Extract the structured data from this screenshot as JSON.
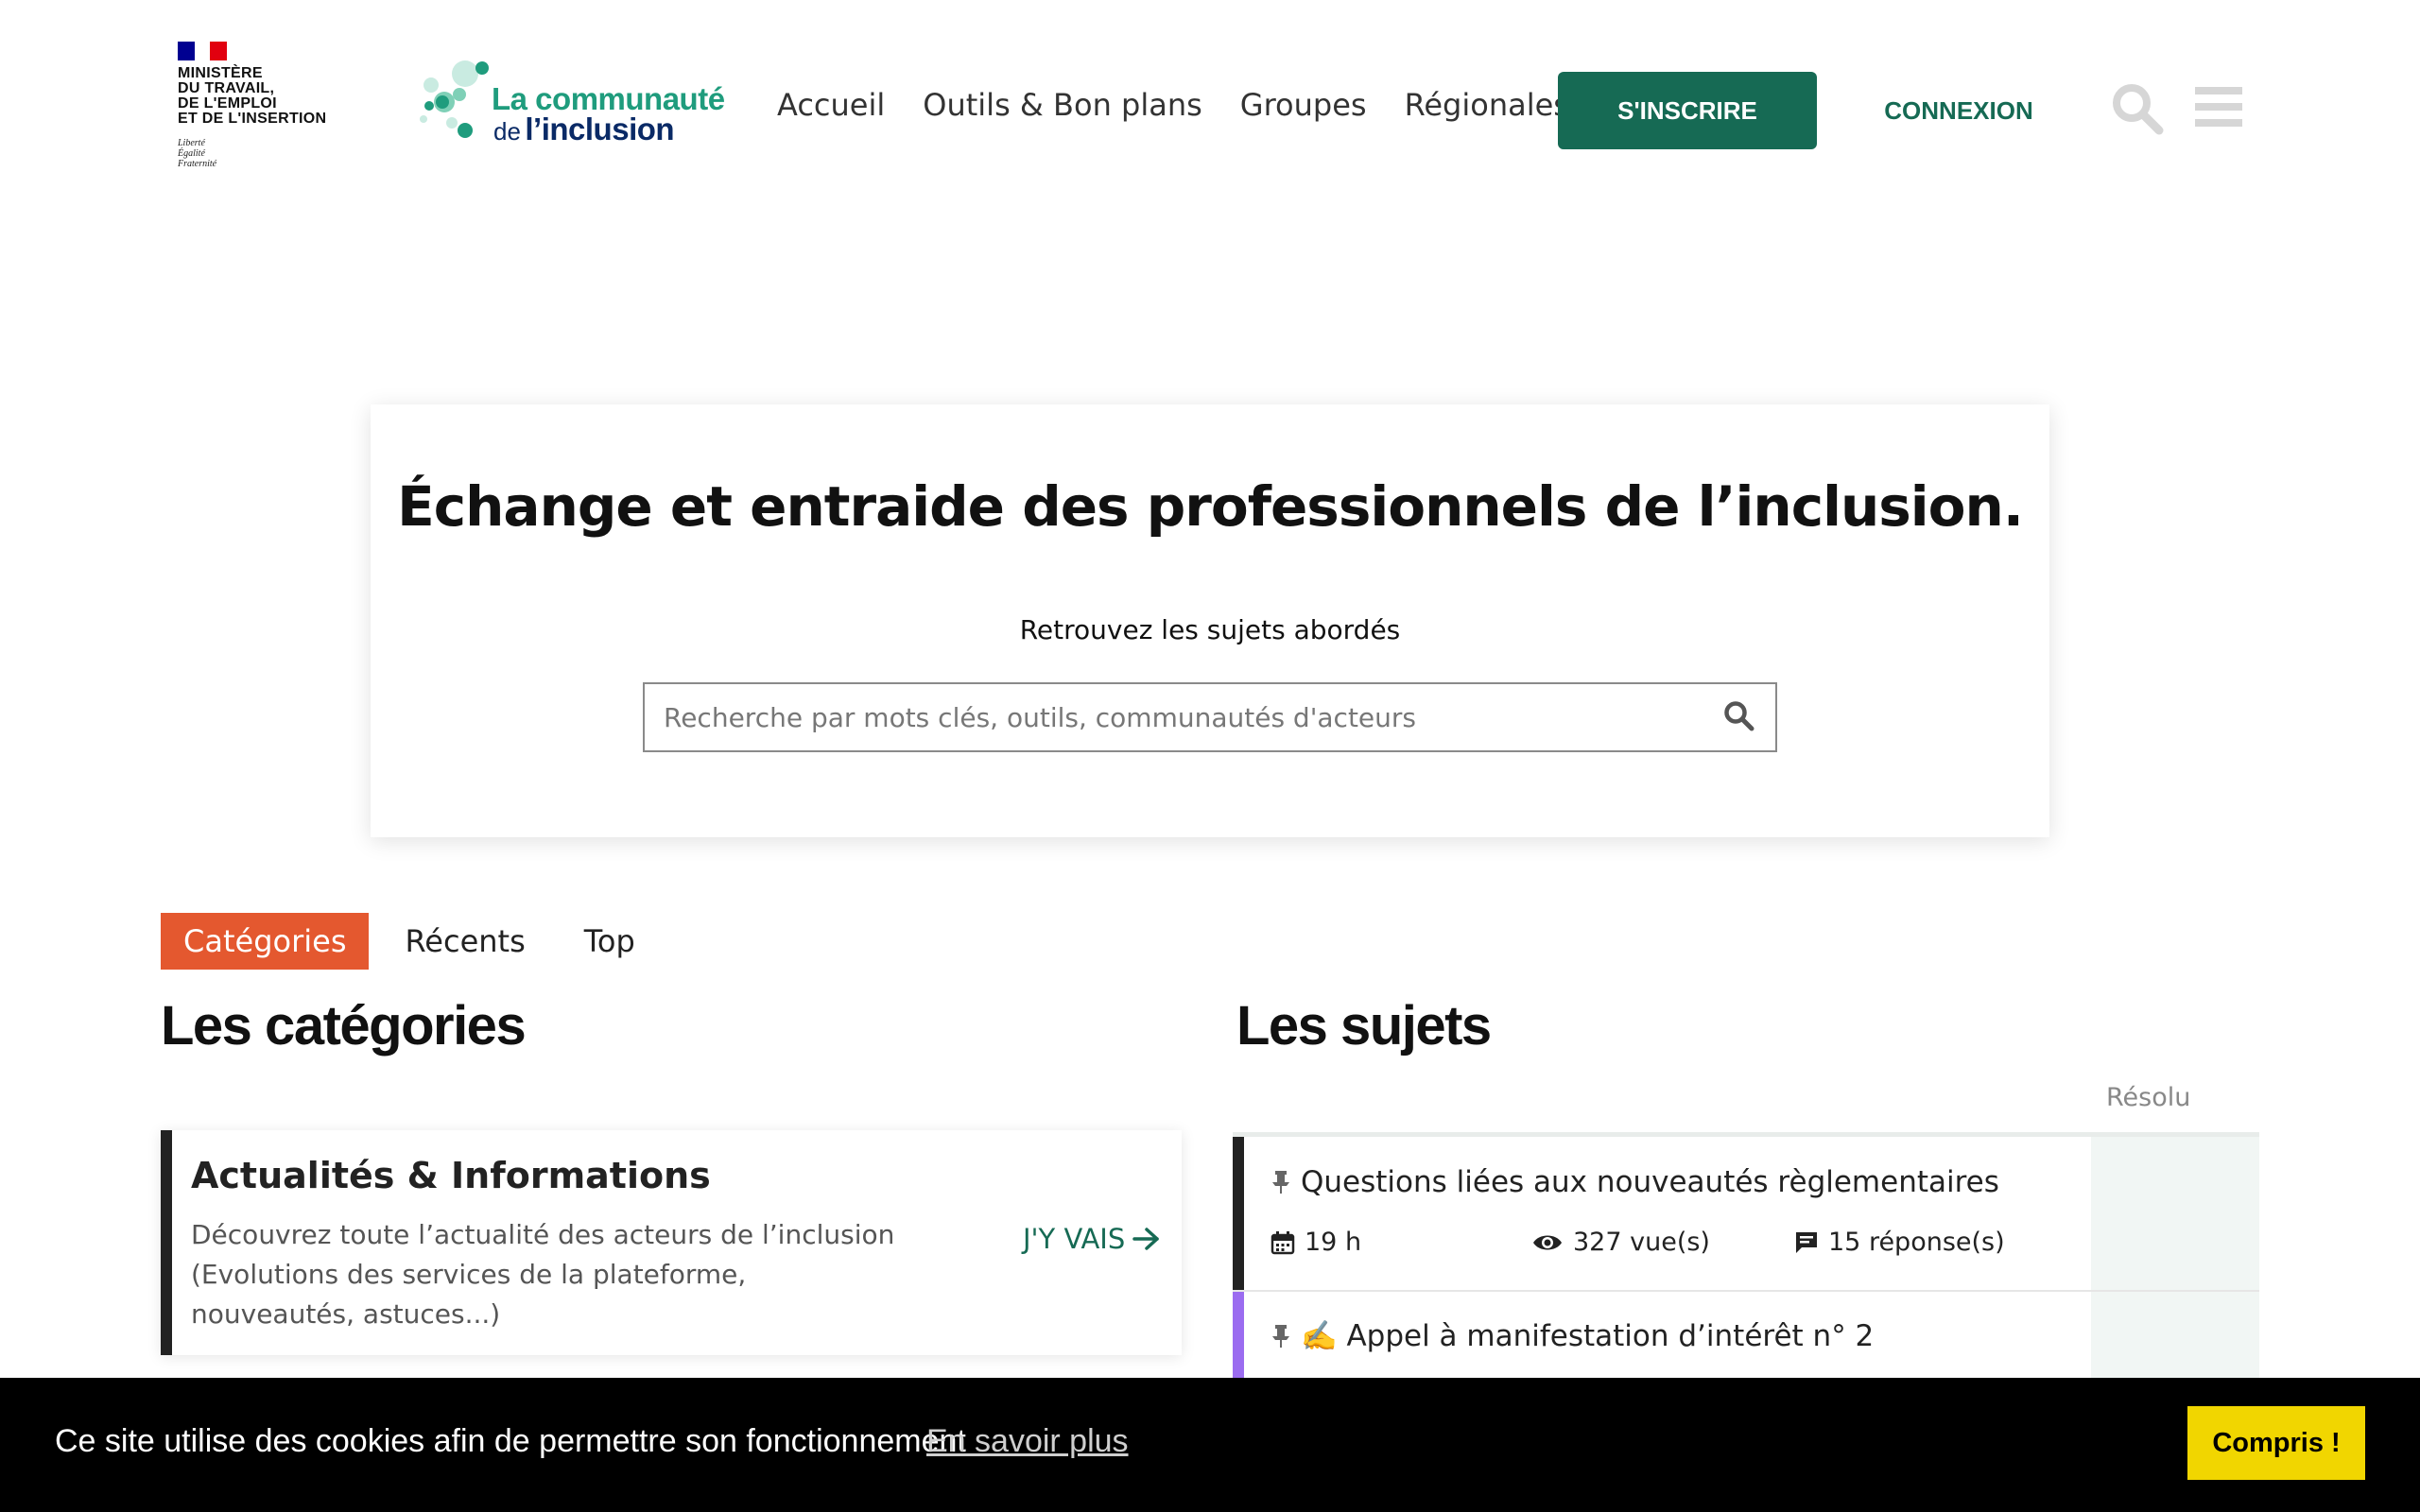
{
  "header": {
    "gov_logo": {
      "lines": [
        "MINISTÈRE",
        "DU TRAVAIL,",
        "DE L'EMPLOI",
        "ET DE L'INSERTION"
      ],
      "motto": [
        "Liberté",
        "Égalité",
        "Fraternité"
      ]
    },
    "site_logo": {
      "line1": "La communauté",
      "line2_prefix": "de",
      "line2_main": "l’inclusion"
    },
    "nav": [
      "Accueil",
      "Outils & Bon plans",
      "Groupes",
      "Régionales"
    ],
    "signup_label": "S'INSCRIRE",
    "login_label": "CONNEXION",
    "icons": {
      "search": "search-icon",
      "menu": "hamburger-menu-icon"
    }
  },
  "hero": {
    "title_regular": "Échange et entraide ",
    "title_bold": "des professionnels de l’inclusion",
    "title_end": ".",
    "subtitle": "Retrouvez les sujets abordés",
    "search_placeholder": "Recherche par mots clés, outils, communautés d'acteurs"
  },
  "tabs": [
    {
      "label": "Catégories",
      "active": true
    },
    {
      "label": "Récents",
      "active": false
    },
    {
      "label": "Top",
      "active": false
    }
  ],
  "categories": {
    "heading": "Les catégories",
    "items": [
      {
        "title": "Actualités & Informations",
        "description": "Découvrez toute l’actualité des acteurs de l’inclusion (Evolutions des services de la plateforme, nouveautés, astuces...)",
        "link_label": "J'Y VAIS",
        "color": "#222222"
      }
    ]
  },
  "topics": {
    "heading": "Les sujets",
    "resolved_column": "Résolu",
    "items": [
      {
        "title": "Questions liées aux nouveautés règlementaires",
        "pinned": true,
        "age": "19 h",
        "views": "327 vue(s)",
        "replies": "15 réponse(s)",
        "color": "#222222"
      },
      {
        "title": "✍️ Appel à manifestation d’intérêt n° 2",
        "pinned": true,
        "color": "#9b6cf0"
      }
    ]
  },
  "cookie_banner": {
    "text": "Ce site utilise des cookies afin de permettre son fonctionnement",
    "link": "En savoir plus",
    "button": "Compris !"
  },
  "colors": {
    "primary_green": "#166a54",
    "logo_green": "#1f9c7d",
    "logo_navy": "#0a2a66",
    "tab_active": "#e4582f",
    "cookie_button": "#f1d600"
  }
}
